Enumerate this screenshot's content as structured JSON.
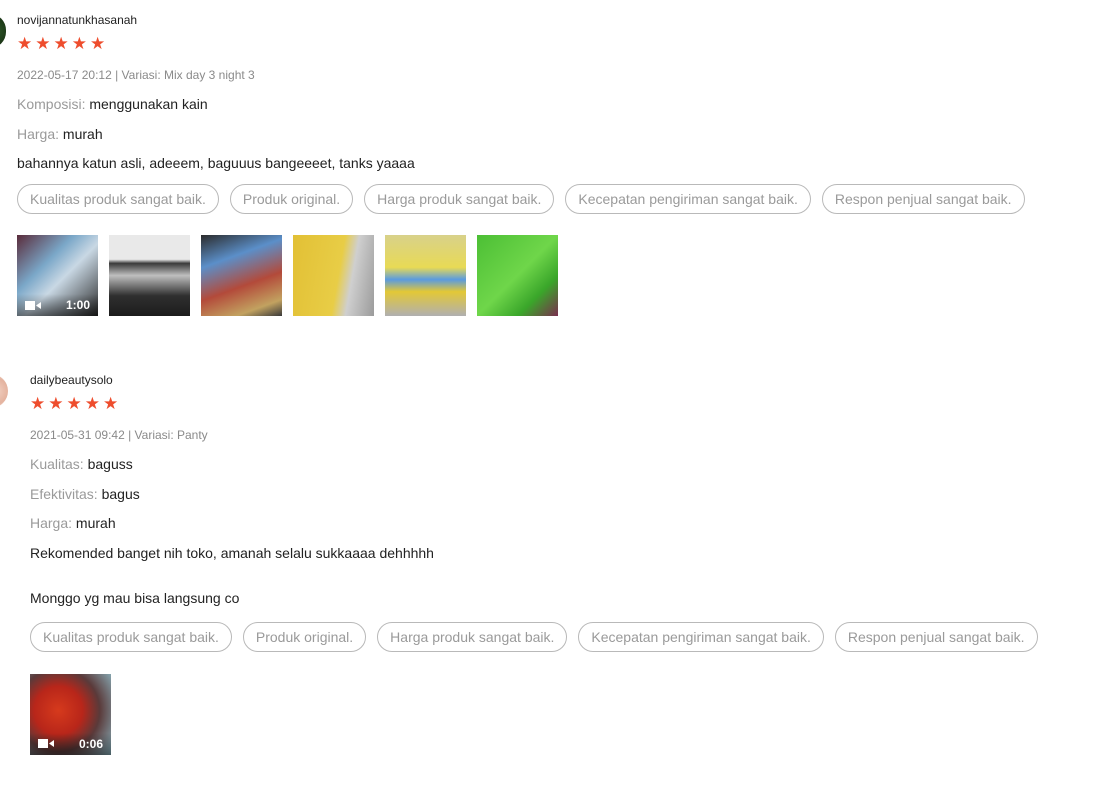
{
  "colors": {
    "star": "#ee4d2d",
    "label": "#9a9a9a",
    "text": "#222222",
    "tag_border": "#b9b9b9"
  },
  "reviews": [
    {
      "username": "novijannatunkhasanah",
      "rating": 5,
      "meta": "2022-05-17 20:12 | Variasi: Mix day 3 night 3",
      "attributes": [
        {
          "key": "Komposisi:",
          "value": "menggunakan kain"
        },
        {
          "key": "Harga:",
          "value": "murah"
        }
      ],
      "comments": [
        "bahannya katun asli, adeeem, baguuus bangeeeet, tanks yaaaa"
      ],
      "tags": [
        "Kualitas produk sangat baik.",
        "Produk original.",
        "Harga produk sangat baik.",
        "Kecepatan pengiriman sangat baik.",
        "Respon penjual sangat baik."
      ],
      "media": [
        {
          "type": "video",
          "duration": "1:00"
        },
        {
          "type": "image"
        },
        {
          "type": "image"
        },
        {
          "type": "image"
        },
        {
          "type": "image"
        },
        {
          "type": "image"
        }
      ]
    },
    {
      "username": "dailybeautysolo",
      "rating": 5,
      "meta": "2021-05-31 09:42 | Variasi: Panty",
      "attributes": [
        {
          "key": "Kualitas:",
          "value": "baguss"
        },
        {
          "key": "Efektivitas:",
          "value": "bagus"
        },
        {
          "key": "Harga:",
          "value": "murah"
        }
      ],
      "comments": [
        "Rekomended banget nih toko, amanah selalu sukkaaaa dehhhhh",
        "Monggo yg mau bisa langsung co"
      ],
      "tags": [
        "Kualitas produk sangat baik.",
        "Produk original.",
        "Harga produk sangat baik.",
        "Kecepatan pengiriman sangat baik.",
        "Respon penjual sangat baik."
      ],
      "media": [
        {
          "type": "video",
          "duration": "0:06"
        }
      ]
    }
  ]
}
